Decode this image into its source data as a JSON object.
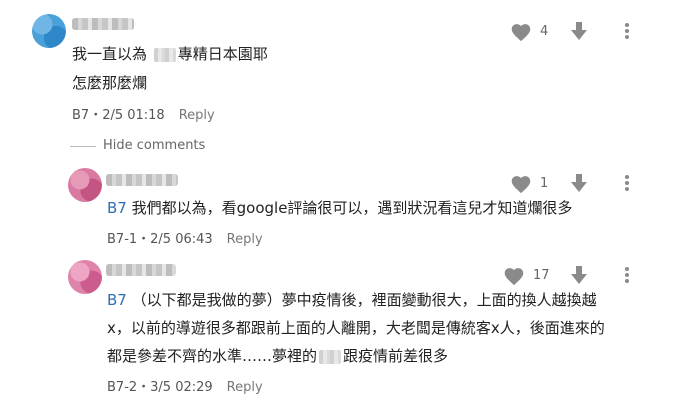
{
  "comments": [
    {
      "lines": [
        [
          "我一直以為 ",
          "專精日本園耶"
        ],
        [
          "怎麼那麼爛"
        ]
      ],
      "meta": "B7・2/5 01:18",
      "reply": "Reply",
      "likes": "4"
    }
  ],
  "hide_comments": "Hide comments",
  "replies": [
    {
      "mention": "B7",
      "lines": [
        "我們都以為，看google評論很可以，遇到狀況看這兒才知道爛很多"
      ],
      "meta": "B7-1・2/5 06:43",
      "reply": "Reply",
      "likes": "1"
    },
    {
      "mention": "B7",
      "line1": "（以下都是我做的夢）夢中疫情後，裡面變動很大，上面的換人越換越",
      "line2": "x，以前的導遊很多都跟前上面的人離開，大老闆是傳統客x人，後面進來的",
      "line3a": "都是參差不齊的水準……夢裡的",
      "line3b": "跟疫情前差很多",
      "meta": "B7-2・3/5 02:29",
      "reply": "Reply",
      "likes": "17"
    }
  ]
}
